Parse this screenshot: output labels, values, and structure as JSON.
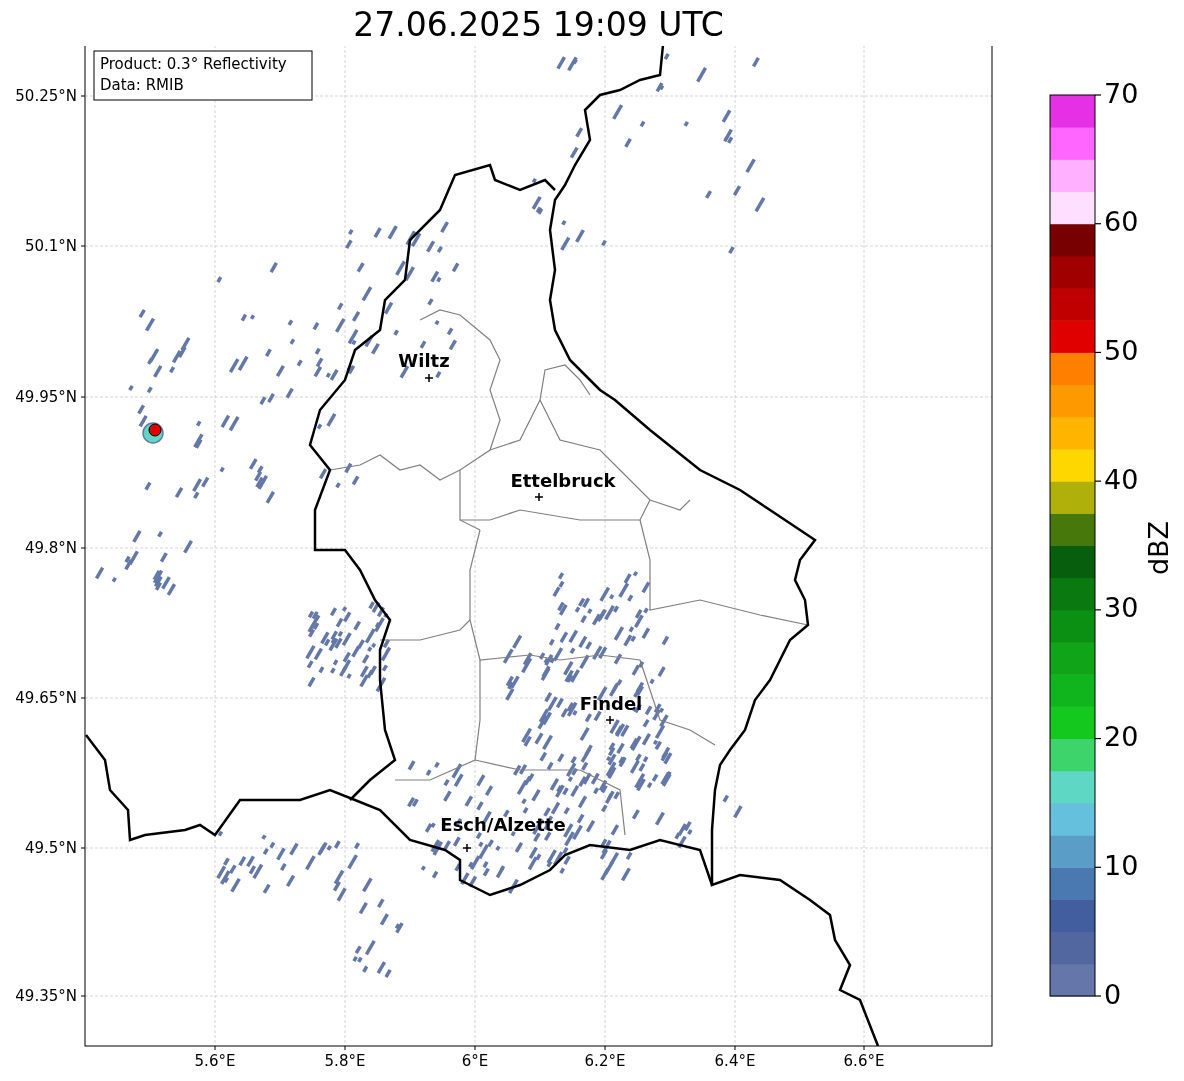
{
  "title": "27.06.2025 19:09 UTC",
  "info_box": {
    "lines": [
      "Product: 0.3° Reflectivity",
      "Data: RMIB"
    ]
  },
  "map": {
    "y_ticks": [
      "50.25°N",
      "50.1°N",
      "49.95°N",
      "49.8°N",
      "49.65°N",
      "49.5°N",
      "49.35°N"
    ],
    "x_ticks": [
      "5.6°E",
      "5.8°E",
      "6°E",
      "6.2°E",
      "6.4°E",
      "6.6°E"
    ],
    "cities": [
      {
        "name": "Wiltz"
      },
      {
        "name": "Ettelbruck"
      },
      {
        "name": "Findel"
      },
      {
        "name": "Esch/Alzette"
      }
    ]
  },
  "colorbar": {
    "label": "dBZ",
    "ticks": [
      "70",
      "60",
      "50",
      "40",
      "30",
      "20",
      "10",
      "0"
    ],
    "steps": [
      {
        "color": "#6477a8"
      },
      {
        "color": "#52679f"
      },
      {
        "color": "#425e9f"
      },
      {
        "color": "#4a78b0"
      },
      {
        "color": "#5a9ec8"
      },
      {
        "color": "#64c0dc"
      },
      {
        "color": "#5ed8c4"
      },
      {
        "color": "#3ed46c"
      },
      {
        "color": "#14c81e"
      },
      {
        "color": "#10b41c"
      },
      {
        "color": "#10a418"
      },
      {
        "color": "#0c9014"
      },
      {
        "color": "#0a7a10"
      },
      {
        "color": "#075e0c"
      },
      {
        "color": "#46780c"
      },
      {
        "color": "#b0b00a"
      },
      {
        "color": "#ffd700"
      },
      {
        "color": "#ffb400"
      },
      {
        "color": "#ff9900"
      },
      {
        "color": "#ff7f00"
      },
      {
        "color": "#e00000"
      },
      {
        "color": "#c00000"
      },
      {
        "color": "#a00000"
      },
      {
        "color": "#780000"
      },
      {
        "color": "#ffdfff"
      },
      {
        "color": "#ffb0ff"
      },
      {
        "color": "#ff66ff"
      },
      {
        "color": "#e630e6"
      }
    ]
  }
}
